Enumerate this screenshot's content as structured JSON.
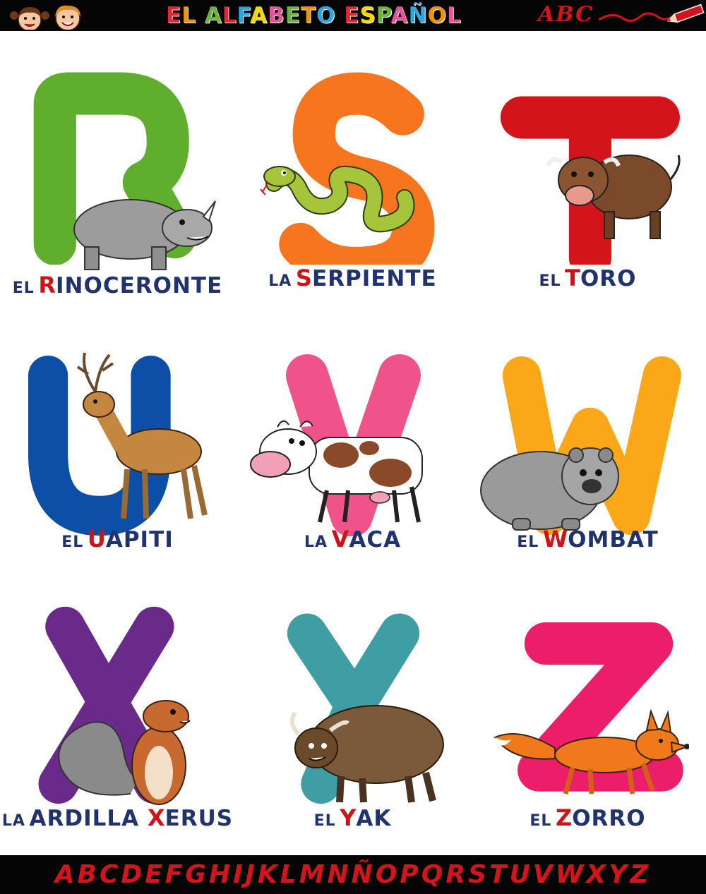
{
  "header": {
    "title_letters": [
      {
        "ch": "E",
        "color": "#e6262c"
      },
      {
        "ch": "L",
        "color": "#f39200"
      },
      {
        "ch": " ",
        "color": "#fff"
      },
      {
        "ch": "A",
        "color": "#6cb33f"
      },
      {
        "ch": "L",
        "color": "#e6262c"
      },
      {
        "ch": "F",
        "color": "#2ea7e0"
      },
      {
        "ch": "A",
        "color": "#f6d600"
      },
      {
        "ch": "B",
        "color": "#e85298"
      },
      {
        "ch": "E",
        "color": "#6cb33f"
      },
      {
        "ch": "T",
        "color": "#f39200"
      },
      {
        "ch": "O",
        "color": "#2ea7e0"
      },
      {
        "ch": " ",
        "color": "#fff"
      },
      {
        "ch": "E",
        "color": "#e6262c"
      },
      {
        "ch": "S",
        "color": "#f6d600"
      },
      {
        "ch": "P",
        "color": "#6cb33f"
      },
      {
        "ch": "A",
        "color": "#e85298"
      },
      {
        "ch": "Ñ",
        "color": "#2ea7e0"
      },
      {
        "ch": "O",
        "color": "#f39200"
      },
      {
        "ch": "L",
        "color": "#e85298"
      }
    ],
    "brand": "ABC"
  },
  "cards": [
    {
      "letter": "R",
      "color": "#5fae2e",
      "article": "EL",
      "word_first": "R",
      "word_rest": "INOCERONTE",
      "animal": "rhinoceros"
    },
    {
      "letter": "S",
      "color": "#f7751f",
      "article": "LA",
      "word_first": "S",
      "word_rest": "ERPIENTE",
      "animal": "snake"
    },
    {
      "letter": "T",
      "color": "#d3141b",
      "article": "EL",
      "word_first": "T",
      "word_rest": "ORO",
      "animal": "bull"
    },
    {
      "letter": "U",
      "color": "#0d4fa6",
      "article": "EL",
      "word_first": "U",
      "word_rest": "APITI",
      "animal": "deer"
    },
    {
      "letter": "V",
      "color": "#f0528a",
      "article": "LA",
      "word_first": "V",
      "word_rest": "ACA",
      "animal": "cow"
    },
    {
      "letter": "W",
      "color": "#fba818",
      "article": "EL",
      "word_first": "W",
      "word_rest": "OMBAT",
      "animal": "wombat"
    },
    {
      "letter": "X",
      "color": "#6a2a8a",
      "article": "LA",
      "word_first": "",
      "word_rest": "ARDILLA ",
      "word_first2": "X",
      "word_rest2": "ERUS",
      "animal": "ground-squirrel"
    },
    {
      "letter": "Y",
      "color": "#3e9ea3",
      "article": "EL",
      "word_first": "Y",
      "word_rest": "AK",
      "animal": "yak"
    },
    {
      "letter": "Z",
      "color": "#ec1e6a",
      "article": "EL",
      "word_first": "Z",
      "word_rest": "ORRO",
      "animal": "fox"
    }
  ],
  "footer": {
    "alphabet": "ABCDEFGHIJKLMNÑOPQRSTUVWXYZ"
  }
}
